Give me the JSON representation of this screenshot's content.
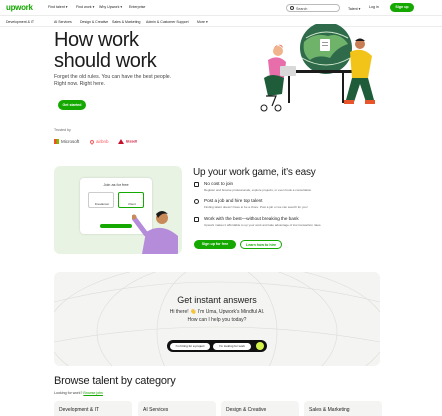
{
  "brand": {
    "logo": "upwork",
    "accent": "#14a800"
  },
  "nav": {
    "links": [
      "Find talent ▾",
      "Find work ▾",
      "Why Upwork ▾",
      "Enterprise"
    ],
    "search_placeholder": "Search",
    "search_option": "Talent ▾",
    "login": "Log in",
    "signup": "Sign up"
  },
  "categories": [
    "Development & IT",
    "AI Services",
    "Design & Creative",
    "Sales & Marketing",
    "Admin & Customer Support",
    "More ▾"
  ],
  "hero": {
    "title_line1": "How work",
    "title_line2": "should work",
    "subtitle_line1": "Forget the old rules. You can have the best people.",
    "subtitle_line2": "Right now. Right here.",
    "cta": "Get started"
  },
  "trusted": {
    "label": "Trusted by",
    "logos": [
      "Microsoft",
      "airbnb",
      "bissell"
    ]
  },
  "work_section": {
    "title": "Up your work game, it’s easy",
    "card_title": "Join as for free",
    "card_options": [
      "Freelancer",
      "Client"
    ],
    "features": [
      {
        "icon": "edit-icon",
        "title": "No cost to join",
        "desc": "Register and browse professionals, explore projects, or even book a consultation."
      },
      {
        "icon": "pin-icon",
        "title": "Post a job and hire top talent",
        "desc": "Finding talent doesn’t have to be a chore. Post a job or we can search for you!"
      },
      {
        "icon": "badge-icon",
        "title": "Work with the best—without breaking the bank",
        "desc": "Upwork makes it affordable to up your work and take advantage of low transaction rates."
      }
    ],
    "primary_button": "Sign up for free",
    "secondary_button": "Learn how to hire"
  },
  "answers": {
    "title": "Get instant answers",
    "line1": "Hi there! 👋 I’m Uma, Upwork’s Mindful AI.",
    "line2": "How can I help you today?",
    "chips": [
      "I’m hiring for a project",
      "I’m looking for work"
    ]
  },
  "browse": {
    "title": "Browse talent by category",
    "sub_text": "Looking for work?",
    "sub_link": "Browse jobs",
    "cards": [
      "Development & IT",
      "AI Services",
      "Design & Creative",
      "Sales & Marketing"
    ]
  }
}
